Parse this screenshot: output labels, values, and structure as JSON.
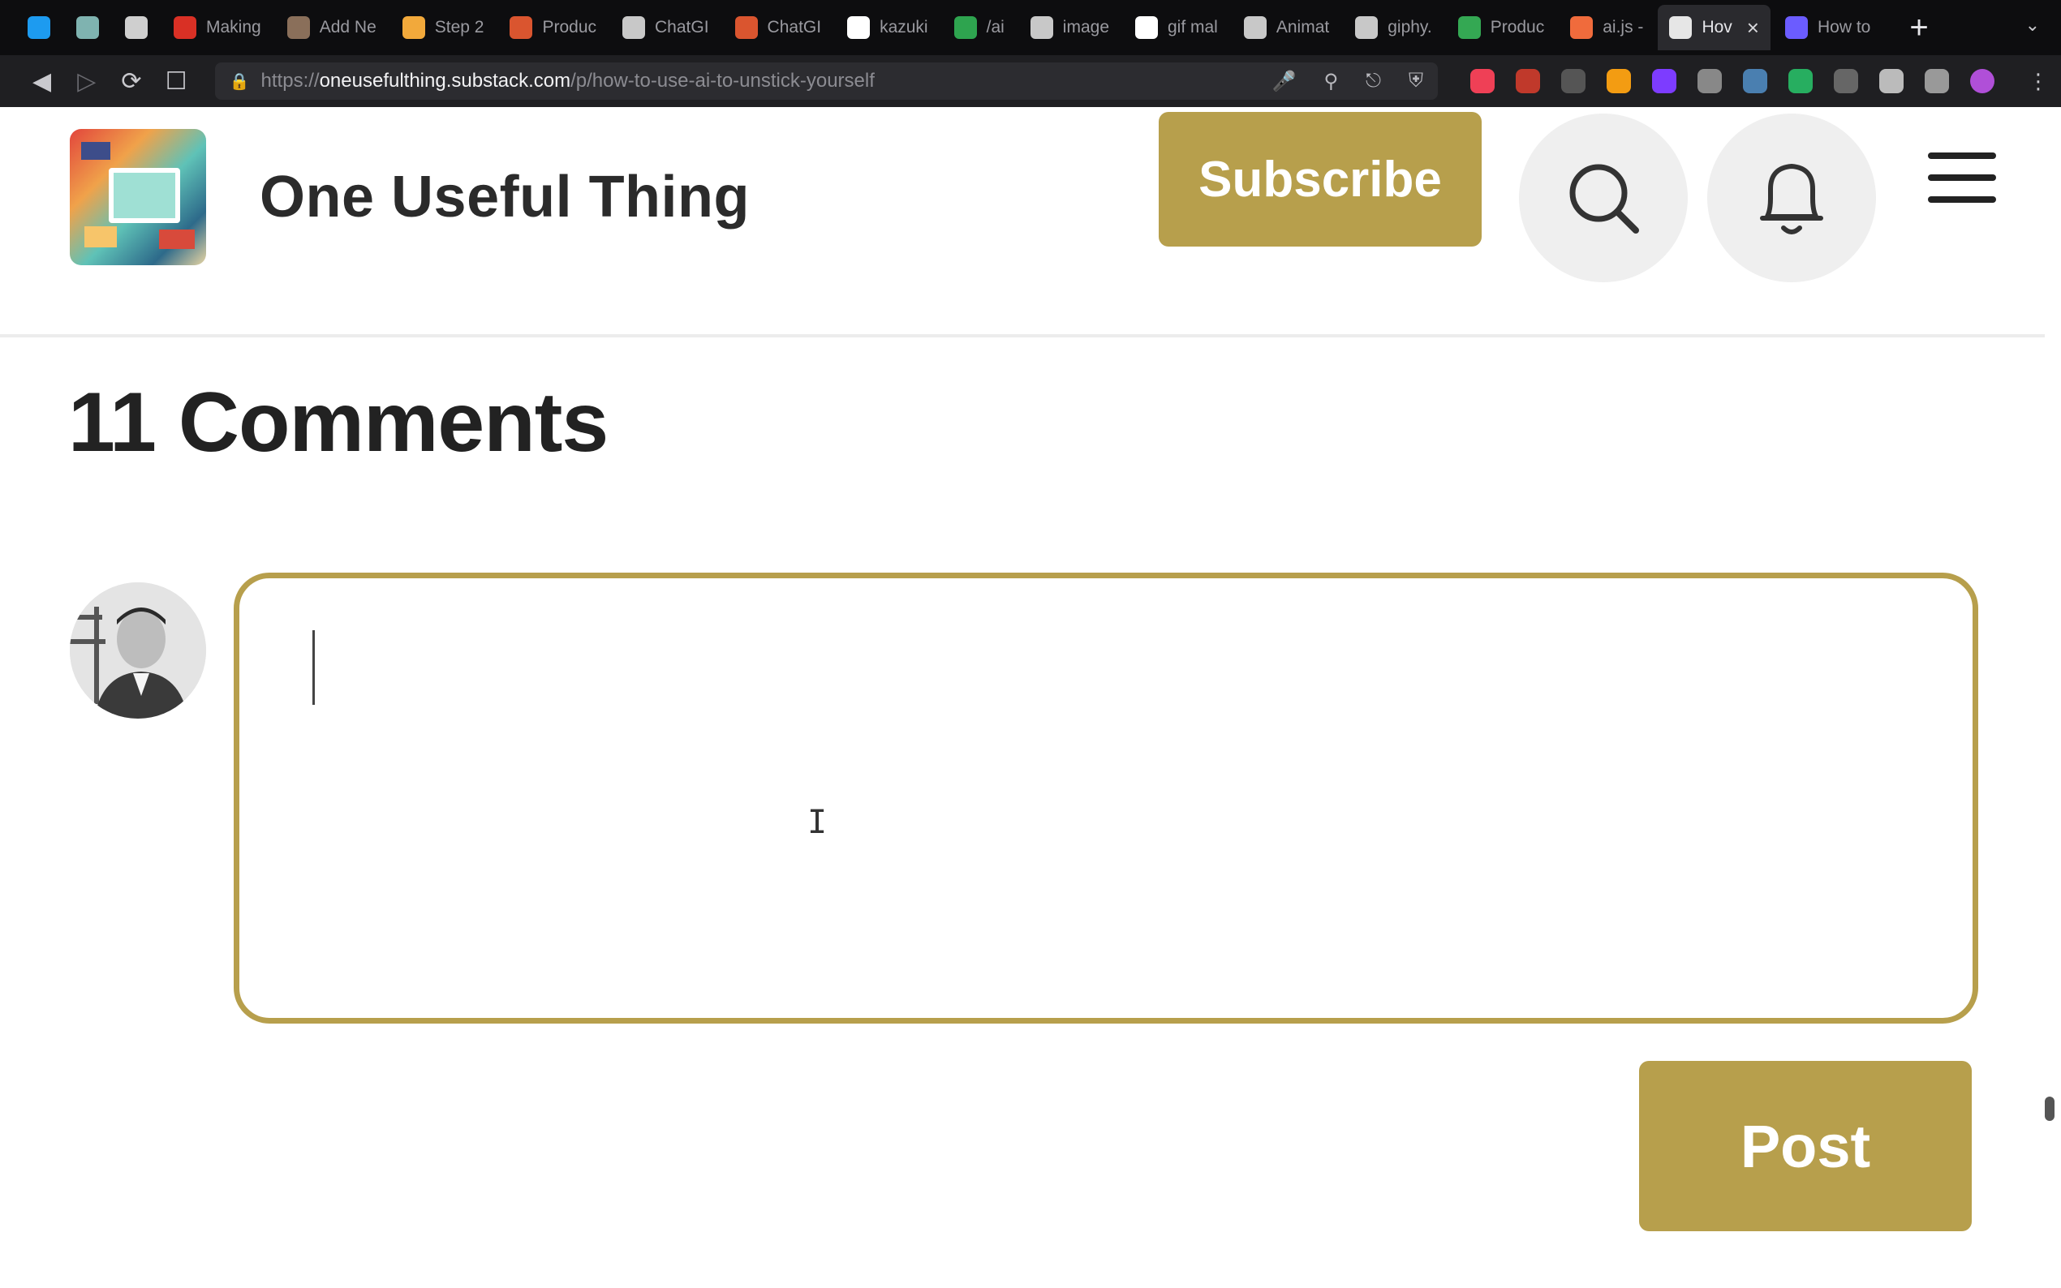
{
  "browser": {
    "tabs": [
      {
        "label": "",
        "icon": "twitter-icon",
        "color": "#1d9bf0"
      },
      {
        "label": "",
        "icon": "app-icon",
        "color": "#7fb3b0"
      },
      {
        "label": "",
        "icon": "bookmark-icon",
        "color": "#cfcfcf"
      },
      {
        "label": "Making",
        "icon": "gmail-icon",
        "color": "#d93025"
      },
      {
        "label": "Add Ne",
        "icon": "image-icon",
        "color": "#8a6f5a"
      },
      {
        "label": "Step 2",
        "icon": "rainbow-icon",
        "color": "#f2a93b"
      },
      {
        "label": "Produc",
        "icon": "producthunt-icon",
        "color": "#da552f"
      },
      {
        "label": "ChatGI",
        "icon": "chatgpt-icon",
        "color": "#c8c8c8"
      },
      {
        "label": "ChatGI",
        "icon": "producthunt-icon",
        "color": "#da552f"
      },
      {
        "label": "kazuki",
        "icon": "github-icon",
        "color": "#ffffff"
      },
      {
        "label": "/ai",
        "icon": "sheet-icon",
        "color": "#2ea44f"
      },
      {
        "label": "image",
        "icon": "globe-icon",
        "color": "#c8c8c8"
      },
      {
        "label": "gif mal",
        "icon": "google-icon",
        "color": "#ffffff"
      },
      {
        "label": "Animat",
        "icon": "doc-icon",
        "color": "#c8c8c8"
      },
      {
        "label": "giphy.",
        "icon": "doc-icon",
        "color": "#c8c8c8"
      },
      {
        "label": "Produc",
        "icon": "drive-icon",
        "color": "#34a853"
      },
      {
        "label": "ai.js -",
        "icon": "arrow-icon",
        "color": "#f06b3c"
      },
      {
        "label": "Hov",
        "icon": "substack-icon",
        "color": "#e6e6e6",
        "active": true
      },
      {
        "label": "How to",
        "icon": "gear-icon",
        "color": "#6b5cff"
      }
    ],
    "url": {
      "prefix": "https://",
      "host": "oneusefulthing.substack.com",
      "path": "/p/how-to-use-ai-to-unstick-yourself"
    }
  },
  "site": {
    "title": "One Useful Thing",
    "subscribe_label": "Subscribe"
  },
  "comments": {
    "heading": "11 Comments",
    "input_value": "",
    "post_label": "Post"
  },
  "colors": {
    "accent": "#b79f4c",
    "chrome_dark": "#0d0d0f",
    "toolbar": "#1f1f22"
  }
}
